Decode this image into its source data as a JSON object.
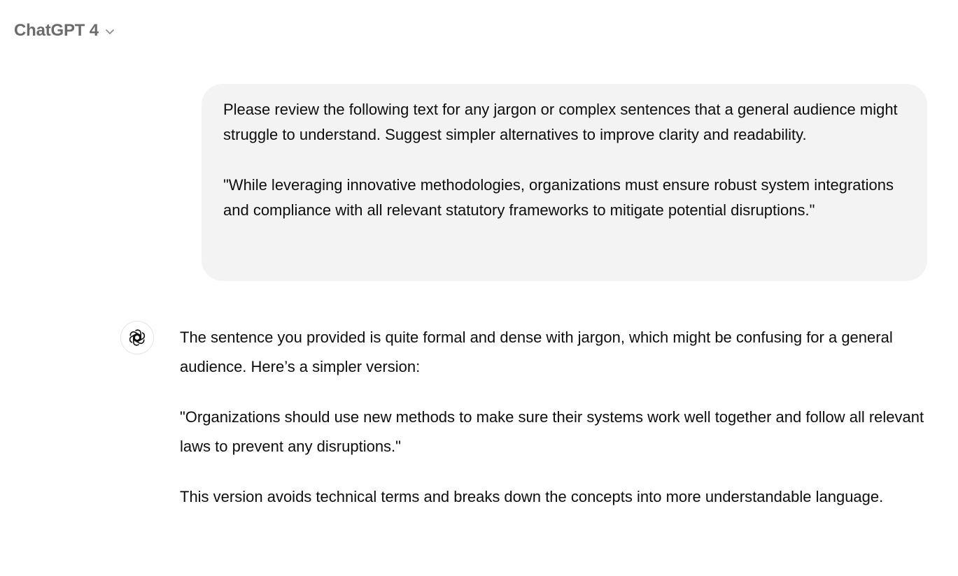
{
  "header": {
    "model_name": "ChatGPT 4",
    "dropdown_icon": "chevron-down-icon"
  },
  "conversation": {
    "user_message": {
      "paragraphs": [
        "Please review the following text for any jargon or complex sentences that a general audience might struggle to understand. Suggest simpler alternatives to improve clarity and readability.",
        "\"While leveraging innovative methodologies, organizations must ensure robust system integrations and compliance with all relevant statutory frameworks to mitigate potential disruptions.\""
      ]
    },
    "assistant_message": {
      "avatar_icon": "openai-logo-icon",
      "paragraphs": [
        "The sentence you provided is quite formal and dense with jargon, which might be confusing for a general audience. Here’s a simpler version:",
        "\"Organizations should use new methods to make sure their systems work well together and follow all relevant laws to prevent any disruptions.\"",
        "This version avoids technical terms and breaks down the concepts into more understandable language."
      ]
    }
  },
  "colors": {
    "background": "#ffffff",
    "user_bubble": "#f3f3f3",
    "text": "#0d0d0d",
    "header_text": "#6b6b6b"
  }
}
